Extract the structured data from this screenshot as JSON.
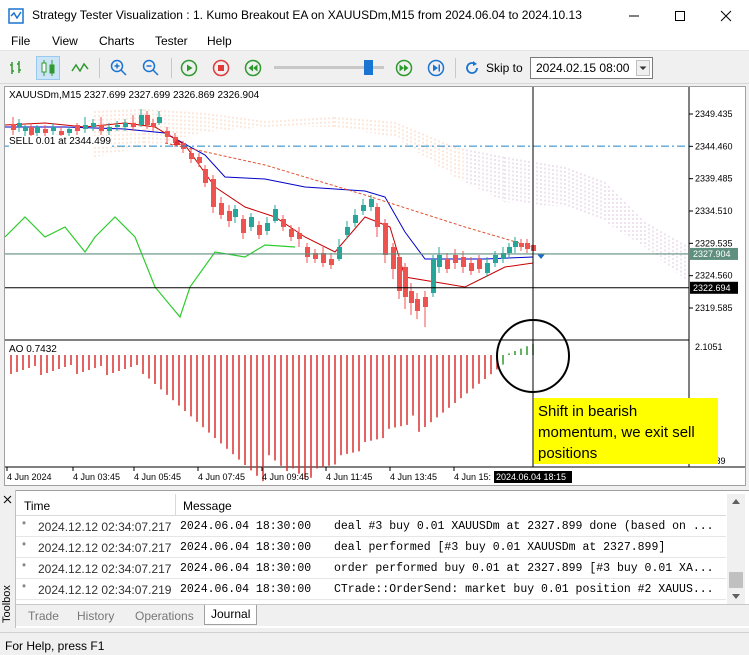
{
  "window": {
    "title": "Strategy Tester Visualization : 1. Kumo Breakout EA on XAUUSDm,M15 from 2024.06.04 to 2024.10.13"
  },
  "menu": [
    "File",
    "View",
    "Charts",
    "Tester",
    "Help"
  ],
  "toolbar": {
    "skip_label": "Skip to",
    "skip_value": "2024.02.15 08:00"
  },
  "chart": {
    "header": "XAUUSDm,M15  2327.699 2327.699 2326.869 2326.904",
    "trade_label": "SELL 0.01 at 2344.499",
    "price_labels": [
      "2349.435",
      "2344.460",
      "2339.485",
      "2334.510",
      "2329.535",
      "2324.560",
      "2319.585"
    ],
    "current_price": "2327.904",
    "crosshair_price": "2322.694",
    "ao_label": "AO 0.7432",
    "ao_top": "2.1051",
    "ao_bottom": "-1.3389",
    "time_labels": [
      "4 Jun 2024",
      "4 Jun 03:45",
      "4 Jun 05:45",
      "4 Jun 07:45",
      "4 Jun 09:45",
      "4 Jun 11:45",
      "4 Jun 13:45",
      "4 Jun 15:"
    ],
    "crosshair_time": "2024.06.04 18:15",
    "callout": "Shift in bearish momentum, we exit sell positions",
    "colors": {
      "bull": "#26a69a",
      "bear": "#ef5350",
      "ao_green": "#2e9a2e",
      "ao_red": "#d9302f",
      "callout": "#ffff00"
    }
  },
  "journal": {
    "columns": [
      "Time",
      "Message"
    ],
    "rows": [
      {
        "time": "2024.12.12 02:34:07.217",
        "tester_time": "2024.06.04 18:30:00",
        "message": "deal #3 buy 0.01 XAUUSDm at 2327.899 done (based on ..."
      },
      {
        "time": "2024.12.12 02:34:07.217",
        "tester_time": "2024.06.04 18:30:00",
        "message": "deal performed [#3 buy 0.01 XAUUSDm at 2327.899]"
      },
      {
        "time": "2024.12.12 02:34:07.217",
        "tester_time": "2024.06.04 18:30:00",
        "message": "order performed buy 0.01 at 2327.899 [#3 buy 0.01 XA..."
      },
      {
        "time": "2024.12.12 02:34:07.219",
        "tester_time": "2024.06.04 18:30:00",
        "message": "CTrade::OrderSend: market buy 0.01 position #2 XAUUS..."
      }
    ],
    "toolbox_label": "Toolbox",
    "tabs": [
      "Trade",
      "History",
      "Operations",
      "Journal"
    ],
    "active_tab": "Journal"
  },
  "status": "For Help, press F1"
}
